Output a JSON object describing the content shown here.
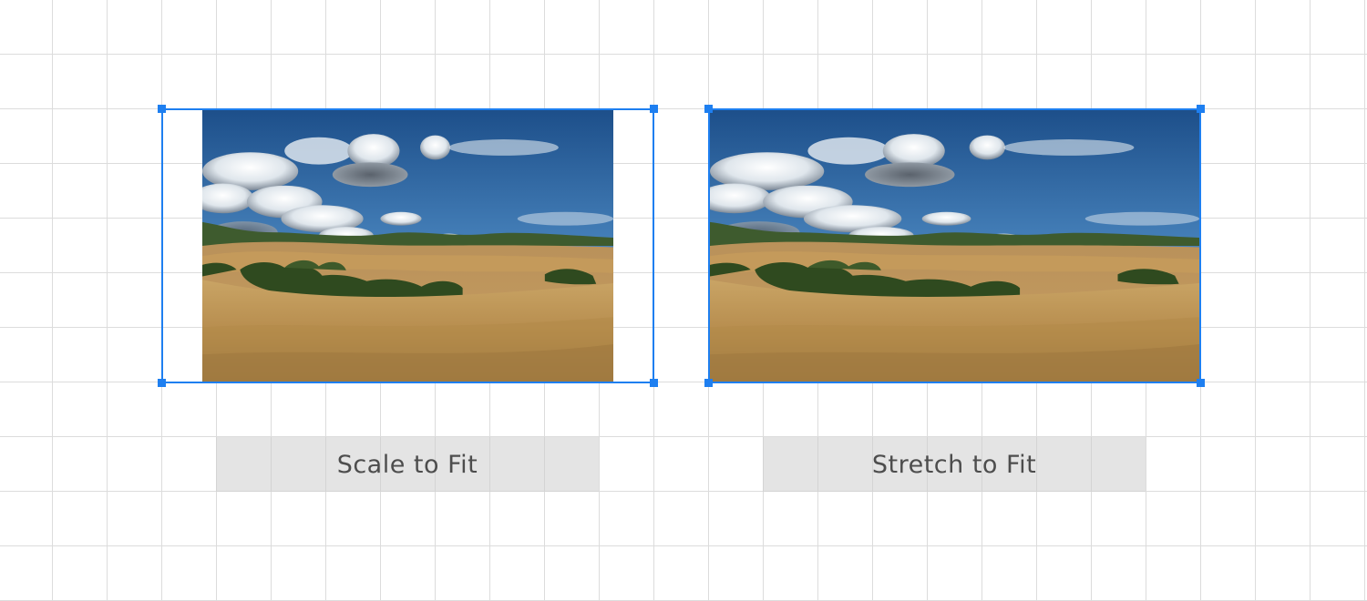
{
  "canvas": {
    "grid_color": "#dcdcdc",
    "selection_color": "#1e7ff0"
  },
  "examples": [
    {
      "label": "Scale to Fit",
      "mode": "scale"
    },
    {
      "label": "Stretch to Fit",
      "mode": "stretch"
    }
  ],
  "image": {
    "subject": "landscape-photo"
  }
}
